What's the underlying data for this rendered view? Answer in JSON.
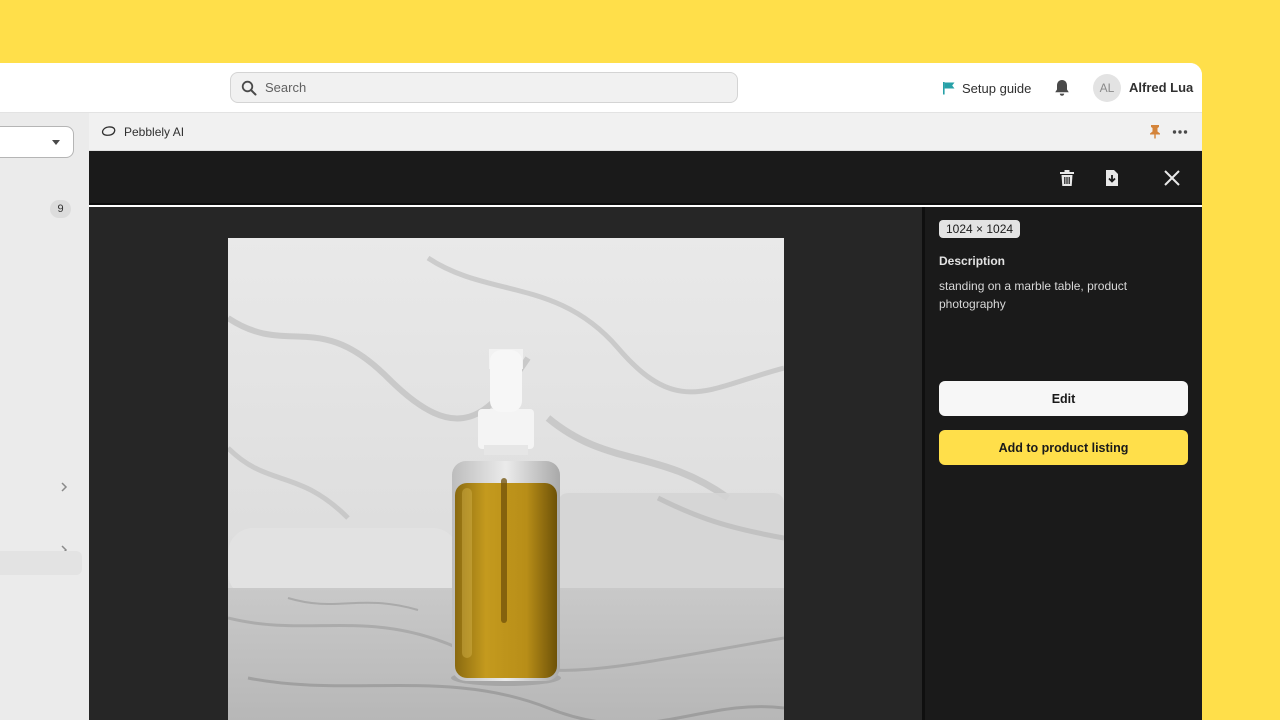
{
  "search": {
    "placeholder": "Search"
  },
  "header": {
    "setup_label": "Setup guide",
    "avatar_initials": "AL",
    "user_name": "Alfred Lua"
  },
  "sidebar": {
    "badge_count": "9"
  },
  "app": {
    "name": "Pebblely AI"
  },
  "panel": {
    "dimensions": "1024 × 1024",
    "description_heading": "Description",
    "description_text": "standing on a marble table, product photography",
    "edit_label": "Edit",
    "add_label": "Add to product listing"
  },
  "colors": {
    "accent_yellow": "#ffdf4a",
    "flag_teal": "#27a1a8",
    "pin_orange": "#d4843a"
  },
  "icons": [
    "search-icon",
    "flag-icon",
    "bell-icon",
    "app-logo-icon",
    "pin-icon",
    "more-icon",
    "trash-icon",
    "download-icon",
    "close-icon",
    "chevron-right-icon",
    "caret-down-icon"
  ]
}
